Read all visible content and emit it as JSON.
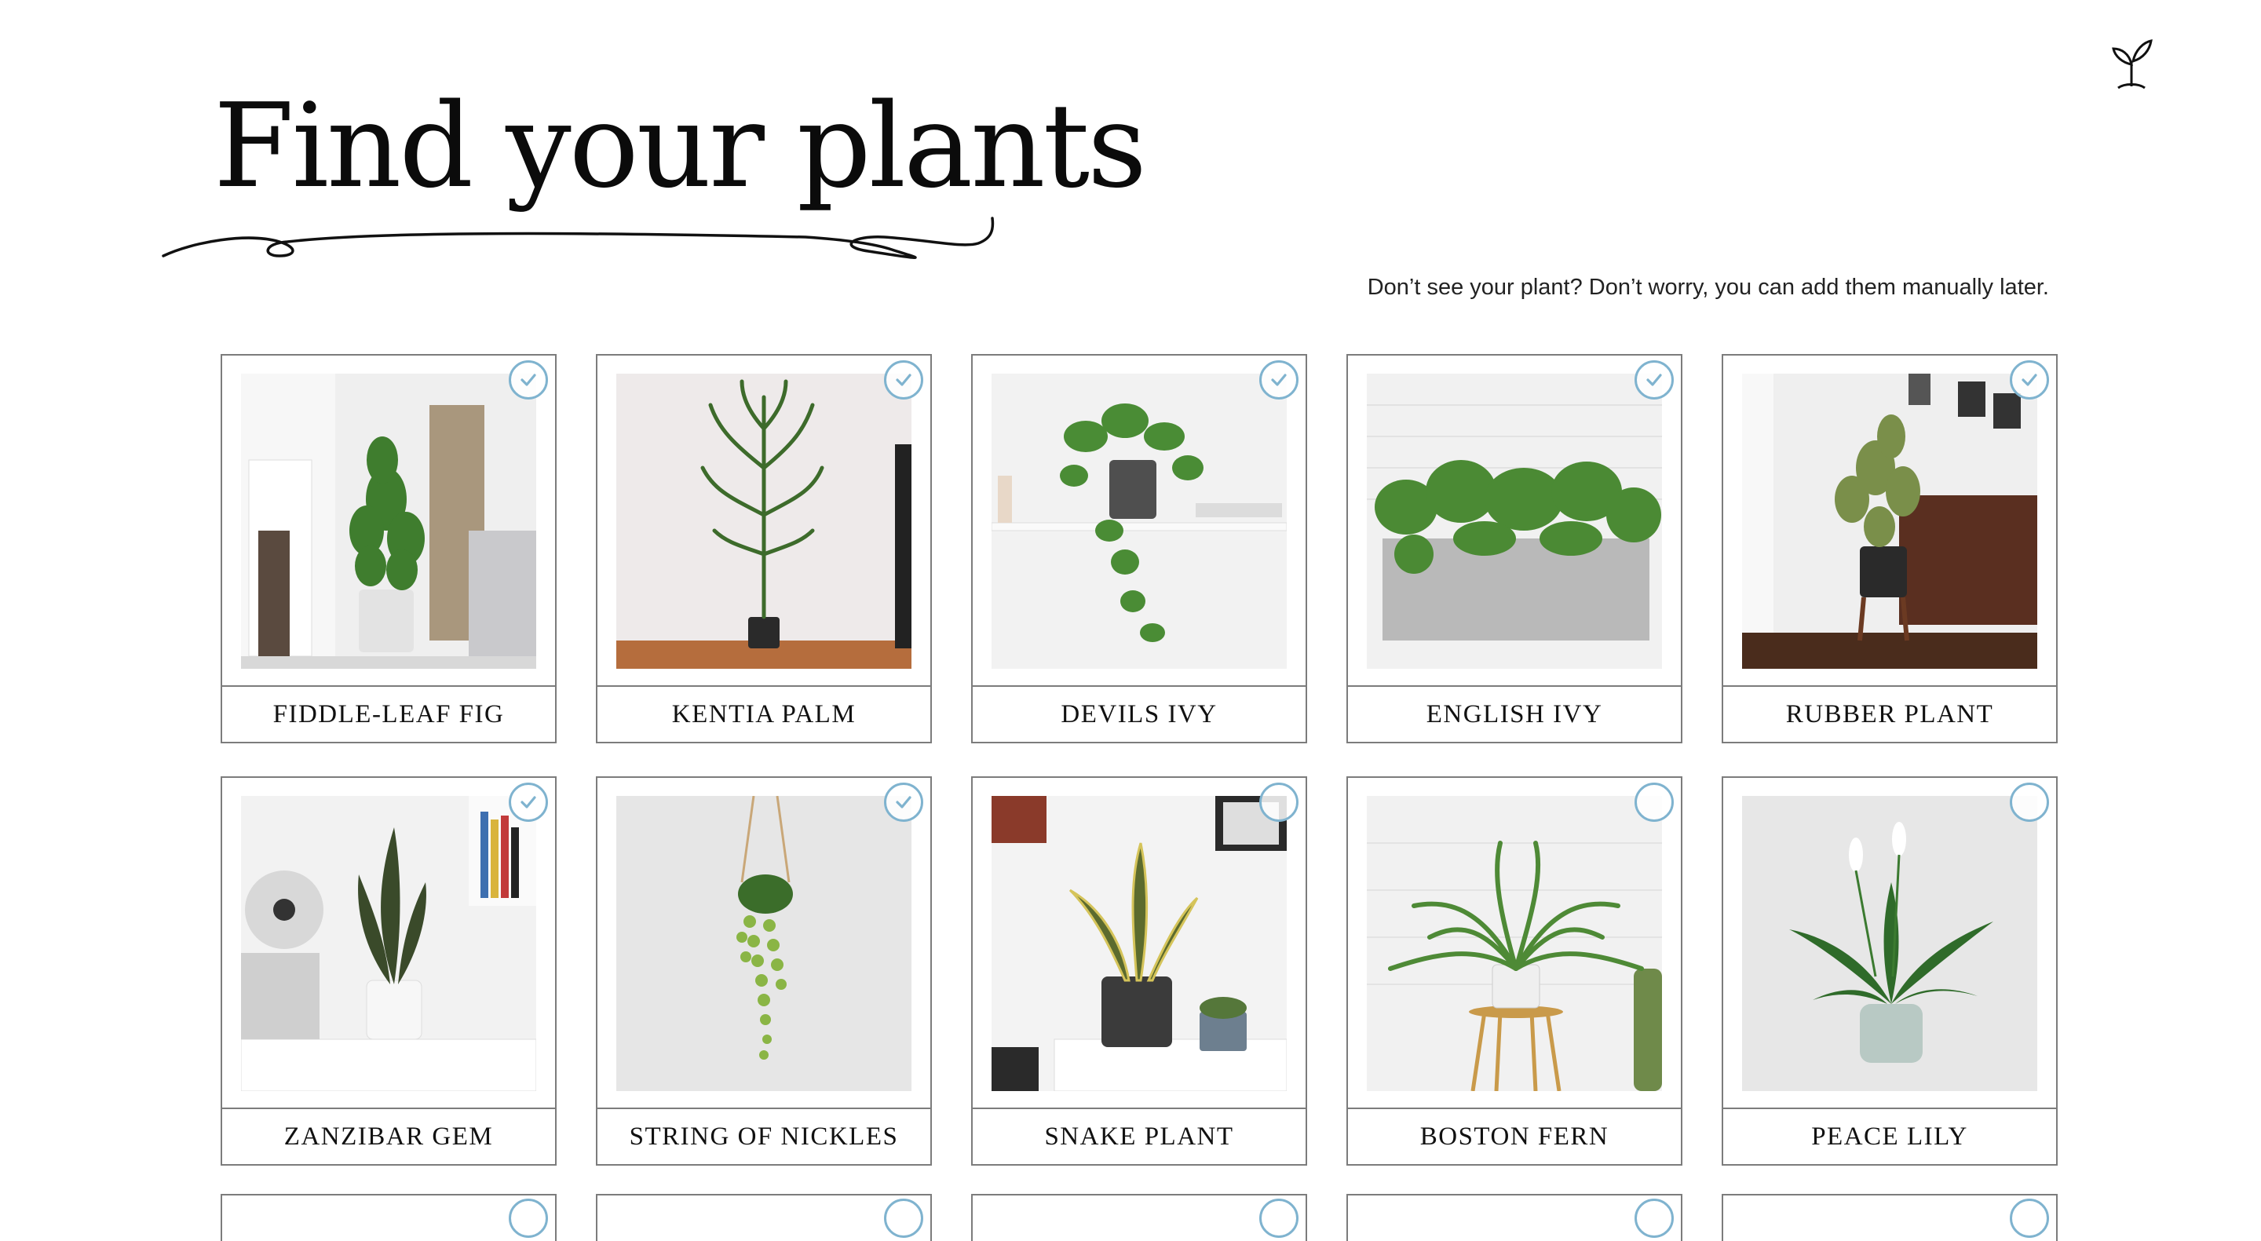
{
  "header": {
    "title": "Find your plants",
    "subtitle": "Don’t see your plant? Don’t worry, you can add them manually later.",
    "logo_icon": "sprout-icon"
  },
  "colors": {
    "check_ring": "#7fb3cf",
    "card_border": "#7c7c7c",
    "text": "#111111"
  },
  "plants": [
    {
      "name": "FIDDLE-LEAF FIG",
      "selected": true
    },
    {
      "name": "KENTIA PALM",
      "selected": true
    },
    {
      "name": "DEVILS IVY",
      "selected": true
    },
    {
      "name": "ENGLISH IVY",
      "selected": true
    },
    {
      "name": "RUBBER PLANT",
      "selected": true
    },
    {
      "name": "ZANZIBAR GEM",
      "selected": true
    },
    {
      "name": "STRING OF NICKLES",
      "selected": true
    },
    {
      "name": "SNAKE PLANT",
      "selected": false
    },
    {
      "name": "BOSTON FERN",
      "selected": false
    },
    {
      "name": "PEACE LILY",
      "selected": false
    }
  ]
}
